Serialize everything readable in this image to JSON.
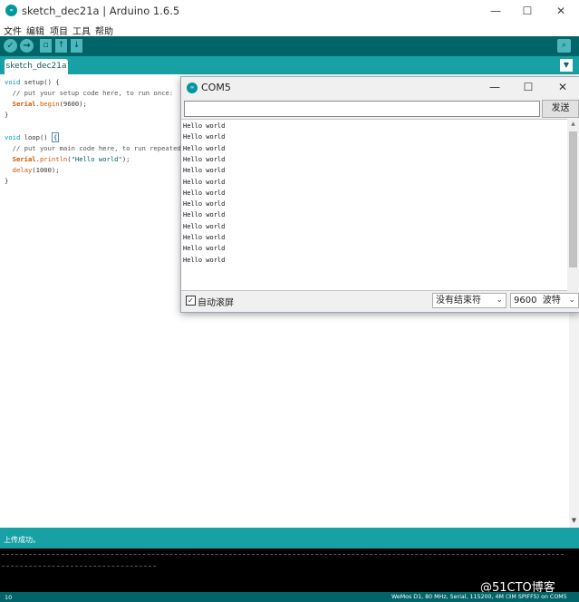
{
  "window": {
    "title": "sketch_dec21a | Arduino 1.6.5",
    "logo_text": "∞"
  },
  "menu": [
    "文件",
    "编辑",
    "项目",
    "工具",
    "帮助"
  ],
  "toolbar": {
    "verify": "✓",
    "upload": "→",
    "new": "▫",
    "open": "↑",
    "save": "↓",
    "serial": "⌕"
  },
  "tab": {
    "name": "sketch_dec21a",
    "menu_arrow": "▼"
  },
  "code": {
    "l1a": "void",
    "l1b": " setup() {",
    "l2": "  // put your setup code here, to run once:",
    "l3a": "Serial",
    "l3b": ".",
    "l3c": "begin",
    "l3d": "(9600);",
    "l4": "}",
    "l6a": "void",
    "l6b": " loop() ",
    "l6c": "{",
    "l7": "  // put your main code here, to run repeatedly:",
    "l8a": "Serial",
    "l8b": ".",
    "l8c": "println",
    "l8d": "(",
    "l8e": "\"Hello world\"",
    "l8f": ");",
    "l9a": "delay",
    "l9b": "(1000);",
    "l10": "}"
  },
  "status": {
    "message": "上传成功。",
    "line": "10",
    "board": "WeMos D1, 80 MHz, Serial, 115200, 4M (3M SPIFFS) on COM5"
  },
  "watermark": "@51CTO博客",
  "serial_monitor": {
    "title": "COM5",
    "logo_text": "∞",
    "send_label": "发送",
    "input_value": "",
    "lines": [
      "Hello world",
      "Hello world",
      "Hello world",
      "Hello world",
      "Hello world",
      "Hello world",
      "Hello world",
      "Hello world",
      "Hello world",
      "Hello world",
      "Hello world",
      "Hello world",
      "Hello world"
    ],
    "autoscroll_label": "自动滚屏",
    "autoscroll_checked": "✓",
    "line_ending": "没有结束符",
    "baud": "9600  波特"
  }
}
